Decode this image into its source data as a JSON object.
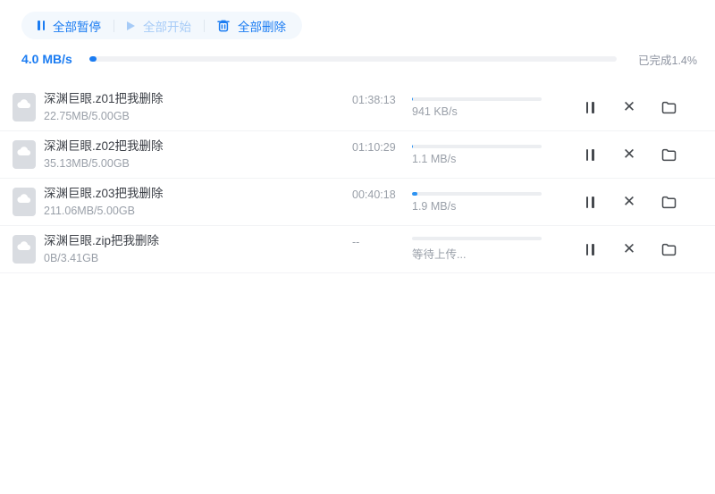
{
  "accent_color": "#1b7cf2",
  "disabled_color": "#a6cbf7",
  "toolbar": {
    "pause_all_label": "全部暂停",
    "start_all_label": "全部开始",
    "delete_all_label": "全部删除"
  },
  "overall": {
    "speed": "4.0 MB/s",
    "completed_label": "已完成1.4%",
    "percent": 1.4
  },
  "list": {
    "rows": [
      {
        "name": "深渊巨眼.z01把我删除",
        "size": "22.75MB/5.00GB",
        "time": "01:38:13",
        "speed": "941 KB/s",
        "percent": 0.44
      },
      {
        "name": "深渊巨眼.z02把我删除",
        "size": "35.13MB/5.00GB",
        "time": "01:10:29",
        "speed": "1.1 MB/s",
        "percent": 0.69
      },
      {
        "name": "深渊巨眼.z03把我删除",
        "size": "211.06MB/5.00GB",
        "time": "00:40:18",
        "speed": "1.9 MB/s",
        "percent": 4.12
      },
      {
        "name": "深渊巨眼.zip把我删除",
        "size": "0B/3.41GB",
        "time": "--",
        "speed": "等待上传...",
        "percent": 0
      }
    ]
  }
}
